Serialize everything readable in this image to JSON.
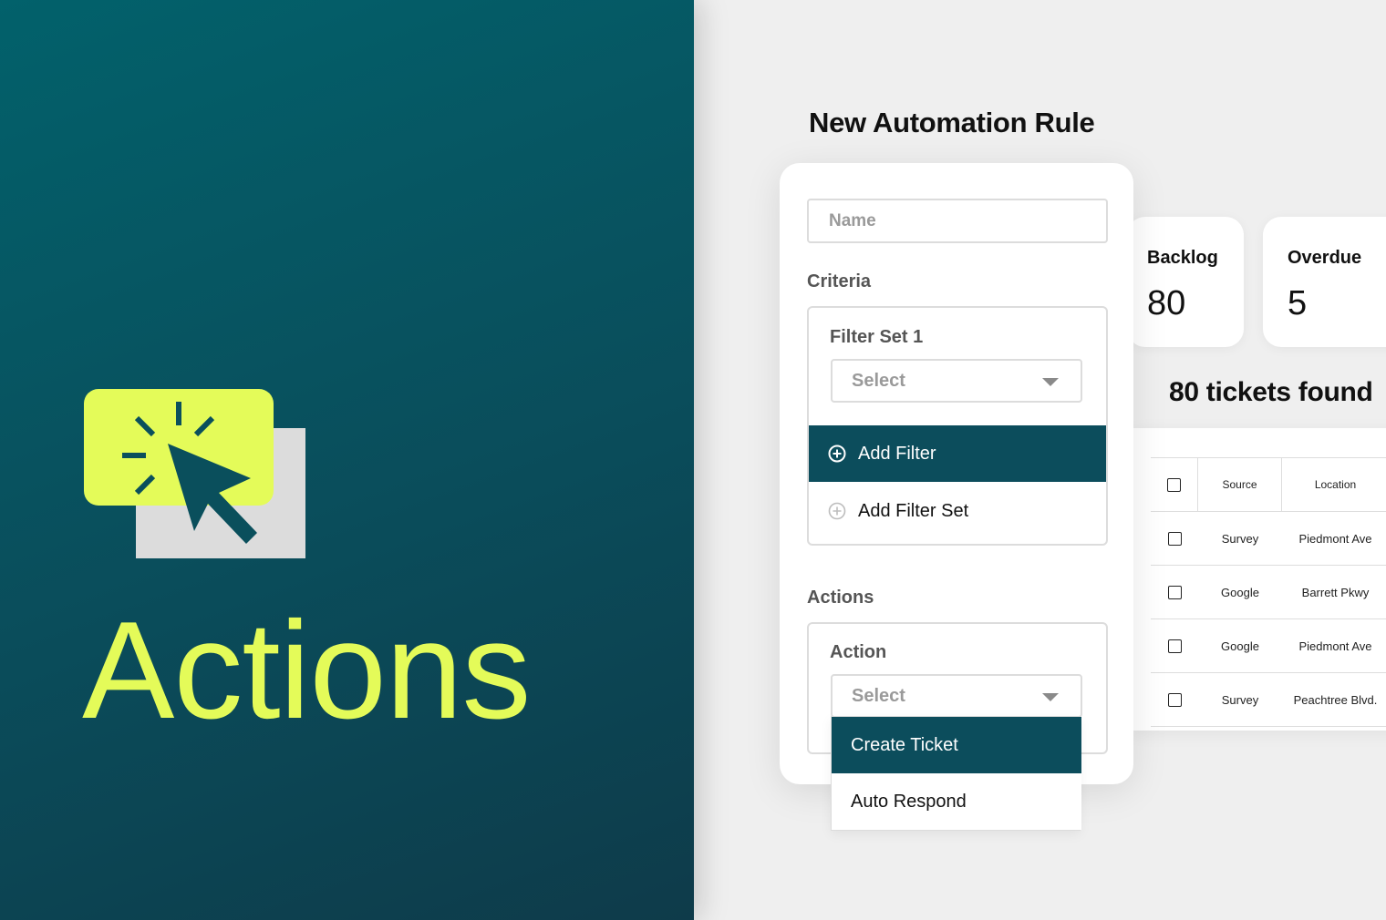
{
  "hero": {
    "title": "Actions",
    "icon": "cursor-click-icon",
    "colors": {
      "background": "#0a4d5b",
      "accent": "#e4fb59"
    }
  },
  "page": {
    "title": "New Automation Rule"
  },
  "form": {
    "name_placeholder": "Name",
    "criteria_label": "Criteria",
    "filter_set": {
      "label": "Filter Set 1",
      "select_value": "Select",
      "add_filter": "Add Filter",
      "add_filter_set": "Add Filter Set"
    },
    "actions_label": "Actions",
    "action": {
      "label": "Action",
      "select_value": "Select",
      "options": [
        "Create Ticket",
        "Auto Respond"
      ],
      "highlighted": "Create Ticket"
    }
  },
  "stats": {
    "backlog": {
      "label": "Backlog",
      "value": "80"
    },
    "overdue": {
      "label": "Overdue",
      "value": "5"
    }
  },
  "results": {
    "count_text": "80 tickets found",
    "columns": [
      "Source",
      "Location"
    ],
    "rows": [
      {
        "source": "Survey",
        "location": "Piedmont Ave"
      },
      {
        "source": "Google",
        "location": "Barrett Pkwy"
      },
      {
        "source": "Google",
        "location": "Piedmont Ave"
      },
      {
        "source": "Survey",
        "location": "Peachtree Blvd."
      }
    ]
  },
  "colors": {
    "primary": "#0c4d5c",
    "panel_bg": "#efefef"
  }
}
